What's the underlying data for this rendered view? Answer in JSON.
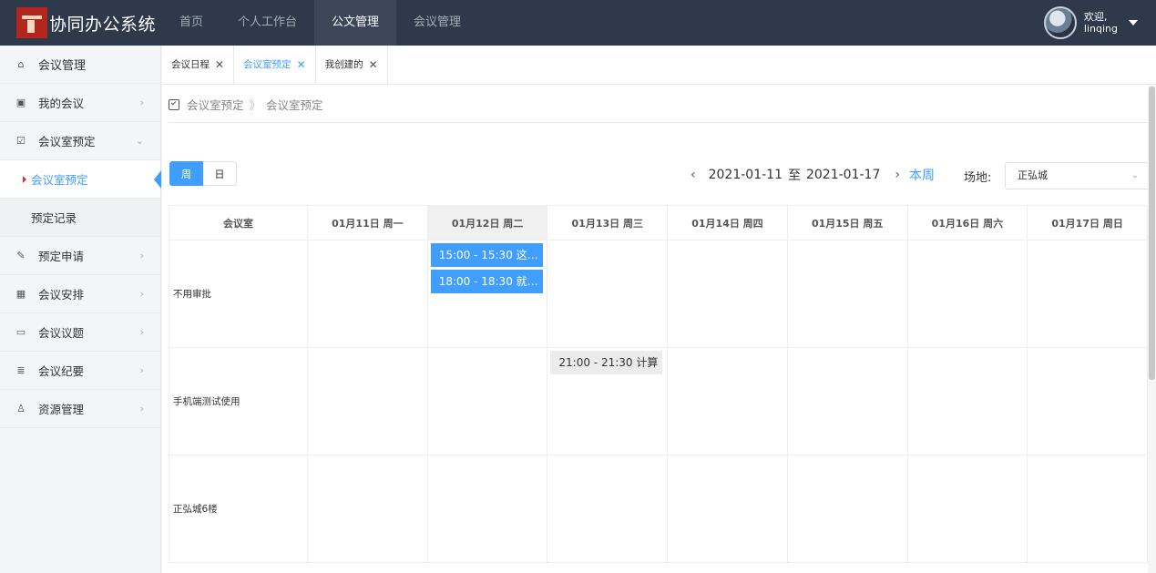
{
  "app": {
    "title": "协同办公系统"
  },
  "nav": [
    {
      "label": "首页",
      "active": false
    },
    {
      "label": "个人工作台",
      "active": false
    },
    {
      "label": "公文管理",
      "active": true
    },
    {
      "label": "会议管理",
      "active": false
    }
  ],
  "user": {
    "greeting": "欢迎,",
    "name": "linqing"
  },
  "sidebar": {
    "header": "会议管理",
    "items": [
      {
        "label": "我的会议",
        "icon": "monitor-icon"
      },
      {
        "label": "会议室预定",
        "icon": "checkbox-icon",
        "expanded": true,
        "children": [
          {
            "label": "会议室预定",
            "active": true
          },
          {
            "label": "预定记录",
            "active": false
          }
        ]
      },
      {
        "label": "预定申请",
        "icon": "edit-note-icon"
      },
      {
        "label": "会议安排",
        "icon": "image-icon"
      },
      {
        "label": "会议议题",
        "icon": "comment-icon"
      },
      {
        "label": "会议纪要",
        "icon": "list-icon"
      },
      {
        "label": "资源管理",
        "icon": "person-icon"
      }
    ]
  },
  "tabs": [
    {
      "label": "会议日程",
      "active": false
    },
    {
      "label": "会议室预定",
      "active": true
    },
    {
      "label": "我创建的",
      "active": false
    }
  ],
  "breadcrumb": {
    "root": "会议室预定",
    "sep": "》",
    "current": "会议室预定"
  },
  "view": {
    "week": "周",
    "day": "日"
  },
  "date_range": {
    "start": "2021-01-11",
    "to": "至",
    "end": "2021-01-17",
    "this_week": "本周"
  },
  "venue": {
    "label": "场地:",
    "value": "正弘城"
  },
  "table": {
    "room_header": "会议室",
    "days": [
      "01月11日 周一",
      "01月12日 周二",
      "01月13日 周三",
      "01月14日 周四",
      "01月15日 周五",
      "01月16日 周六",
      "01月17日 周日"
    ],
    "rooms": [
      {
        "name": "不用审批",
        "events": [
          {
            "day": 1,
            "text": "15:00 - 15:30  这是..."
          },
          {
            "day": 1,
            "text": "18:00 - 18:30  就说..."
          }
        ]
      },
      {
        "name": "手机端测试使用",
        "events": [
          {
            "day": 2,
            "text": "21:00 - 21:30  计算"
          }
        ]
      },
      {
        "name": "正弘城6楼",
        "events": []
      }
    ]
  },
  "colors": {
    "accent": "#409eff",
    "topbar": "#2e3a4b"
  }
}
